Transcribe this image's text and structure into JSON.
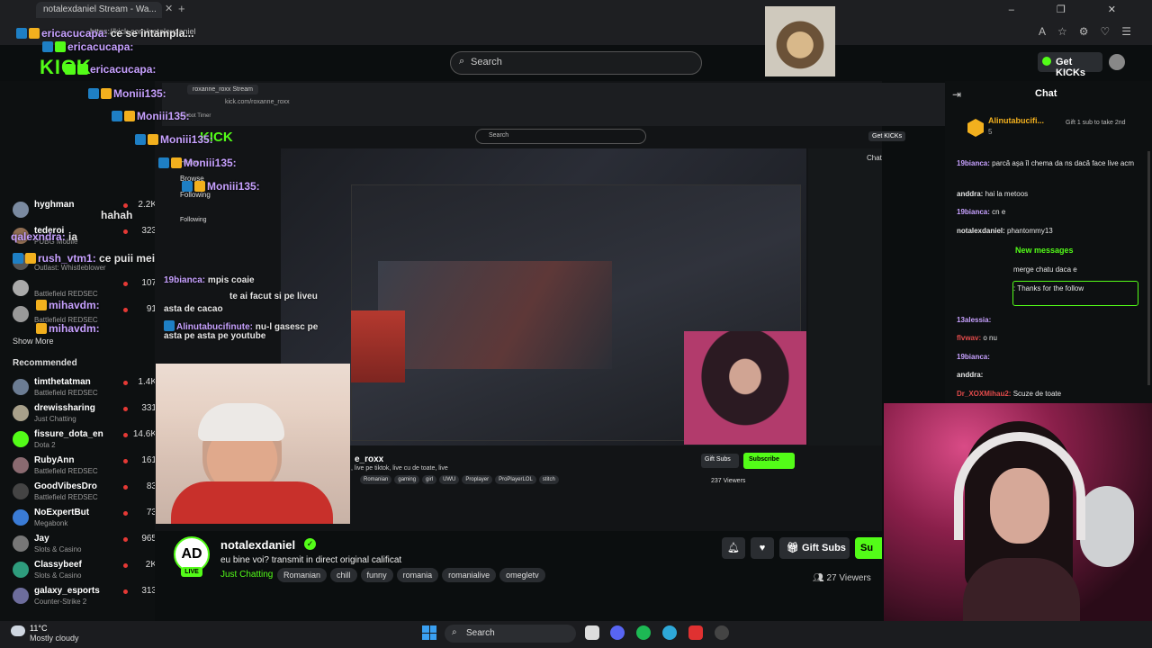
{
  "browser": {
    "tab_title": "notalexdaniel Stream - Wa...",
    "url": "https://kick.com/notalexdaniel",
    "window_controls": "– ❐ ✕"
  },
  "header": {
    "logo": "KICK",
    "search_placeholder": "Search",
    "get_kicks": "Get KICKs"
  },
  "overlay_chat": [
    {
      "user": "ericacucapa:",
      "text": "ce se intampla..."
    },
    {
      "user": "ericacucapa:",
      "text": ""
    },
    {
      "user": "ericacucapa:",
      "text": ""
    },
    {
      "user": "Moniii135:",
      "text": ""
    },
    {
      "user": "Moniii135:",
      "text": ""
    },
    {
      "user": "Moniii135:",
      "text": ""
    },
    {
      "user": "Moniii135:",
      "text": ""
    },
    {
      "user": "Moniii135:",
      "text": ""
    },
    {
      "user": "",
      "text": "hahah"
    },
    {
      "user": "qalexndra:",
      "text": "ia"
    },
    {
      "user": "rush_vtm1:",
      "text": "ce puii mei"
    },
    {
      "user": "mihavdm:",
      "text": ""
    },
    {
      "user": "mihavdm:",
      "text": ""
    },
    {
      "user": "19bianca:",
      "text": "mpis coaie"
    },
    {
      "user": "",
      "text": "te ai facut si pe liveu"
    },
    {
      "user": "",
      "text": "asta de cacao"
    },
    {
      "user": "Alinutabucifinute:",
      "text": "nu-l gasesc pe"
    },
    {
      "user": "",
      "text": "asta pe asta pe youtube"
    }
  ],
  "sidebar": {
    "following": [
      {
        "name": "hyghman",
        "category": "",
        "viewers": "2.2K",
        "color": "#7a8aa0"
      },
      {
        "name": "tederoi",
        "category": "PUBG Mobile",
        "viewers": "323",
        "color": "#8f6d52"
      },
      {
        "name": "",
        "category": "Outlast: Whistleblower",
        "viewers": "",
        "color": "#555"
      },
      {
        "name": "",
        "category": "Battlefield REDSEC",
        "viewers": "107",
        "color": "#aaa"
      },
      {
        "name": "",
        "category": "Battlefield REDSEC",
        "viewers": "91",
        "color": "#999"
      }
    ],
    "show_more": "Show More",
    "recommended_title": "Recommended",
    "recommended": [
      {
        "name": "timthetatman",
        "category": "Battlefield REDSEC",
        "viewers": "1.4K",
        "color": "#6b7c93"
      },
      {
        "name": "drewissharing",
        "category": "Just Chatting",
        "viewers": "331",
        "color": "#a8a08a"
      },
      {
        "name": "fissure_dota_en",
        "category": "Dota 2",
        "viewers": "14.6K",
        "color": "#53fc18"
      },
      {
        "name": "RubyAnn",
        "category": "Battlefield REDSEC",
        "viewers": "161",
        "color": "#8a6a70"
      },
      {
        "name": "GoodVibesDro",
        "category": "Battlefield REDSEC",
        "viewers": "83",
        "color": "#444"
      },
      {
        "name": "NoExpertBut",
        "category": "Megabonk",
        "viewers": "73",
        "color": "#3a7bd5"
      },
      {
        "name": "Jay",
        "category": "Slots & Casino",
        "viewers": "965",
        "color": "#777"
      },
      {
        "name": "Classybeef",
        "category": "Slots & Casino",
        "viewers": "2K",
        "color": "#2e9c7d"
      },
      {
        "name": "galaxy_esports",
        "category": "Counter-Strike 2",
        "viewers": "313",
        "color": "#6d6d9c"
      }
    ]
  },
  "nested": {
    "tab": "roxanne_roxx Stream",
    "url": "kick.com/roxanne_roxx",
    "kickbot": "Kickbot Timer",
    "logo": "KICK",
    "search": "Search",
    "get_kicks": "Get KICKs",
    "nav": [
      "Home",
      "Browse",
      "Following",
      "Following"
    ],
    "chat_title": "Chat",
    "streamer": "e_roxx",
    "desc": ", live pe tiktok, live cu de toate, live",
    "tags": [
      "Romanian",
      "gaming",
      "girl",
      "UWU",
      "Proplayer",
      "ProPlayerLOL",
      "stitch"
    ],
    "gift_subs": "Gift Subs",
    "subscribe": "Subscribe",
    "viewers": "237 Viewers"
  },
  "stream_info": {
    "avatar_text": "AD",
    "live": "LIVE",
    "streamer": "notalexdaniel",
    "title": "eu bine voi? transmit in direct original calificat",
    "category": "Just Chatting",
    "tags": [
      "Romanian",
      "chill",
      "funny",
      "romania",
      "romanialive",
      "omegletv"
    ],
    "gift_subs": "Gift Subs",
    "subscribe": "Su",
    "viewers": "27 Viewers"
  },
  "chat": {
    "title": "Chat",
    "pinned_user": "Alinutabucifi...",
    "pinned_count": "5",
    "pinned_text": "Gift 1 sub to take 2nd",
    "new_messages": "New messages",
    "messages": [
      {
        "user": "19bianca:",
        "text": "parcă așa îl chema da ns dacă face live acm",
        "color": "#c7a1ff"
      },
      {
        "user": "anddra:",
        "text": "hai la metoos",
        "color": "#e6e6e6"
      },
      {
        "user": "19bianca:",
        "text": "cn e",
        "color": "#c7a1ff"
      },
      {
        "user": "notalexdaniel:",
        "text": "phantommy13",
        "color": "#e6e6e6"
      },
      {
        "user": "",
        "text": "merge chatu daca e",
        "color": "#e6e6e6"
      },
      {
        "user": "",
        "text": ": Thanks for the follow",
        "color": "#e6e6e6"
      },
      {
        "user": "13alessia:",
        "text": "",
        "color": "#c7a1ff"
      },
      {
        "user": "flvwav:",
        "text": "o nu",
        "color": "#e34b4b"
      },
      {
        "user": "19bianca:",
        "text": "",
        "color": "#c7a1ff"
      },
      {
        "user": "anddra:",
        "text": "",
        "color": "#e6e6e6"
      },
      {
        "user": "Dr_XOXMihau2:",
        "text": "Scuze de toate",
        "color": "#e34b4b"
      }
    ]
  },
  "taskbar": {
    "temp": "11°C",
    "weather": "Mostly cloudy",
    "search": "Search"
  },
  "colors": {
    "accent": "#53fc18",
    "background": "#0b0e0f"
  }
}
